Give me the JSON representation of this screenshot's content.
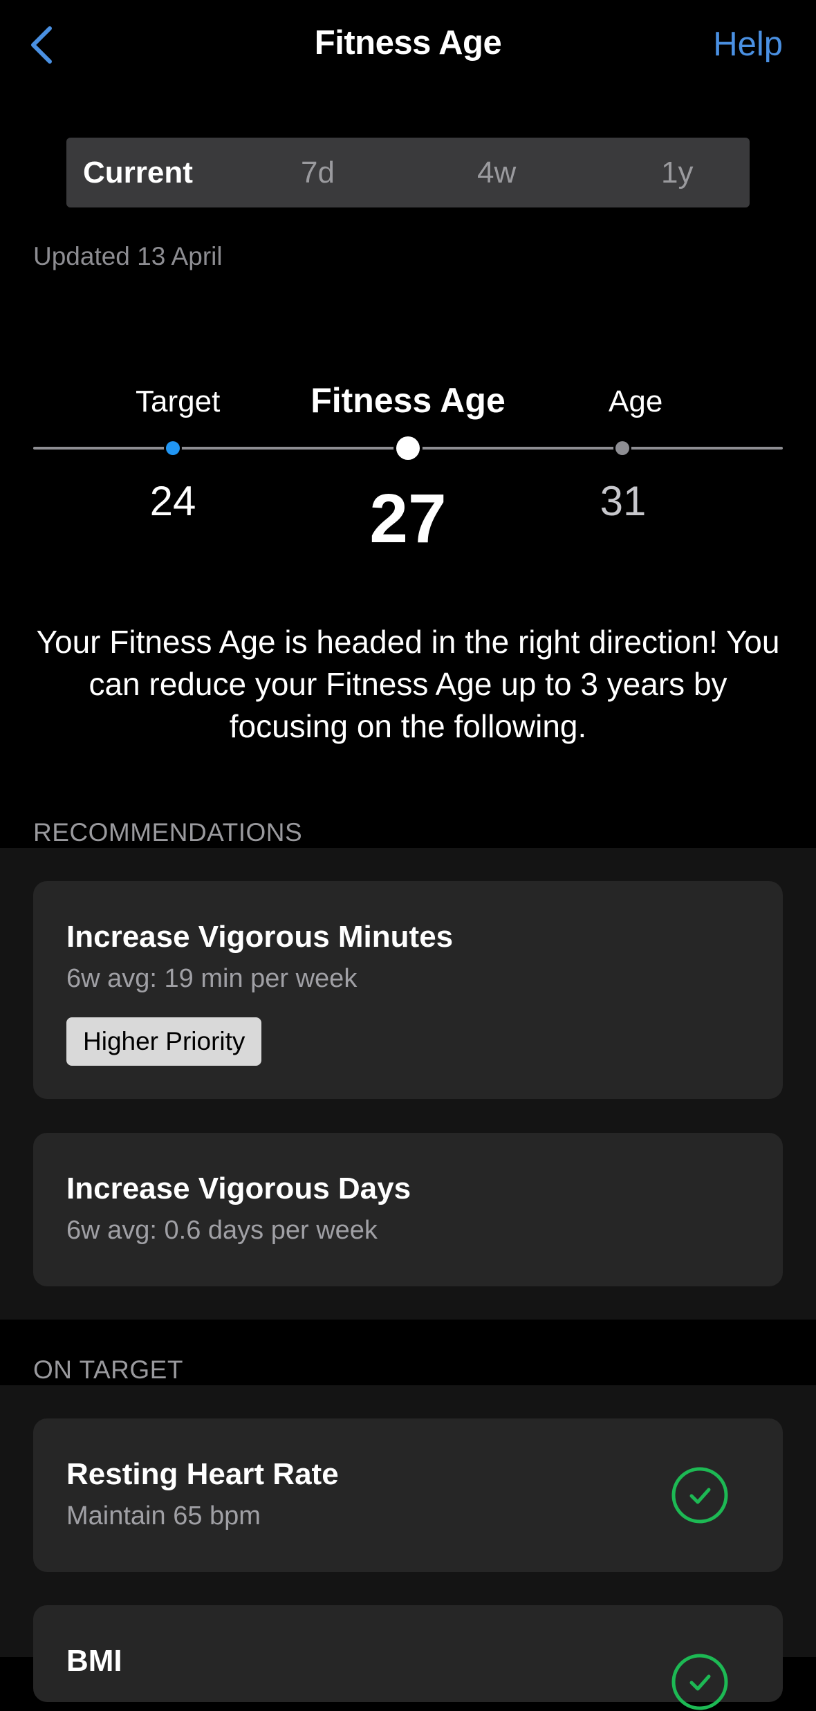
{
  "nav": {
    "title": "Fitness Age",
    "help_label": "Help",
    "back_icon": "chevron-left-icon"
  },
  "tabs": [
    {
      "label": "Current",
      "active": true
    },
    {
      "label": "7d",
      "active": false
    },
    {
      "label": "4w",
      "active": false
    },
    {
      "label": "1y",
      "active": false
    }
  ],
  "updated": "Updated 13 April",
  "gauge": {
    "target_label": "Target",
    "target_value": "24",
    "current_label": "Fitness Age",
    "current_value": "27",
    "age_label": "Age",
    "age_value": "31"
  },
  "message": "Your Fitness Age is headed in the right direction! You can reduce your Fitness Age up to 3 years by focusing on the following.",
  "recommendations": {
    "header": "RECOMMENDATIONS",
    "items": [
      {
        "title": "Increase Vigorous Minutes",
        "subtitle": "6w avg: 19 min per week",
        "badge": "Higher Priority"
      },
      {
        "title": "Increase Vigorous Days",
        "subtitle": "6w avg: 0.6 days per week"
      }
    ]
  },
  "on_target": {
    "header": "ON TARGET",
    "items": [
      {
        "title": "Resting Heart Rate",
        "subtitle": "Maintain 65 bpm",
        "icon": "check-circle-icon"
      },
      {
        "title": "BMI",
        "subtitle": "",
        "icon": "check-circle-icon"
      }
    ]
  },
  "colors": {
    "accent": "#4a90e2",
    "target_dot": "#2196f3",
    "success": "#1db954"
  }
}
